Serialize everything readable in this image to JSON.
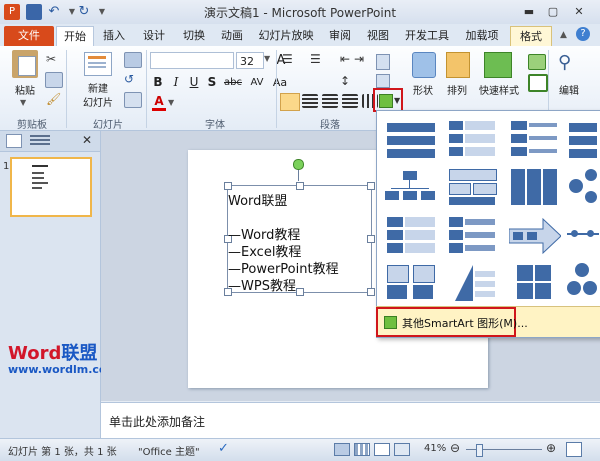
{
  "window": {
    "title": "演示文稿1 - Microsoft PowerPoint"
  },
  "tabs": [
    "文件",
    "开始",
    "插入",
    "设计",
    "切换",
    "动画",
    "幻灯片放映",
    "审阅",
    "视图",
    "开发工具",
    "加载项",
    "格式"
  ],
  "ribbon": {
    "clipboard": {
      "paste": "粘贴",
      "group": "剪贴板"
    },
    "slides": {
      "new_slide_1": "新建",
      "new_slide_2": "幻灯片",
      "group": "幻灯片"
    },
    "font": {
      "font_name": "",
      "font_size": "32",
      "group": "字体",
      "bold": "B",
      "italic": "I",
      "underline": "U",
      "strike": "S",
      "shadow": "abc",
      "spacing": "AV",
      "case": "Aa",
      "color": "A"
    },
    "paragraph": {
      "group": "段落"
    },
    "drawing": {
      "shape": "形状",
      "arrange": "排列",
      "quick_styles": "快速样式"
    },
    "editing": {
      "edit": "编辑"
    }
  },
  "left_pane": {
    "slide_number": "1",
    "logo_word": "Word",
    "logo_cn": "联盟",
    "url": "www.wordlm.com"
  },
  "slide": {
    "lines": [
      "Word联盟",
      "",
      "—Word教程",
      "—Excel教程",
      "—PowerPoint教程",
      "—WPS教程"
    ]
  },
  "notes": {
    "placeholder": "单击此处添加备注"
  },
  "status": {
    "slide_info": "幻灯片 第 1 张，共 1 张",
    "theme": "\"Office 主题\"",
    "zoom": "41%"
  },
  "gallery": {
    "more_smartart": "其他SmartArt 图形(M)..."
  },
  "colors": {
    "accent": "#d84a1b",
    "smartart_blue": "#3f6aa6",
    "highlight_red": "#d0161b"
  }
}
